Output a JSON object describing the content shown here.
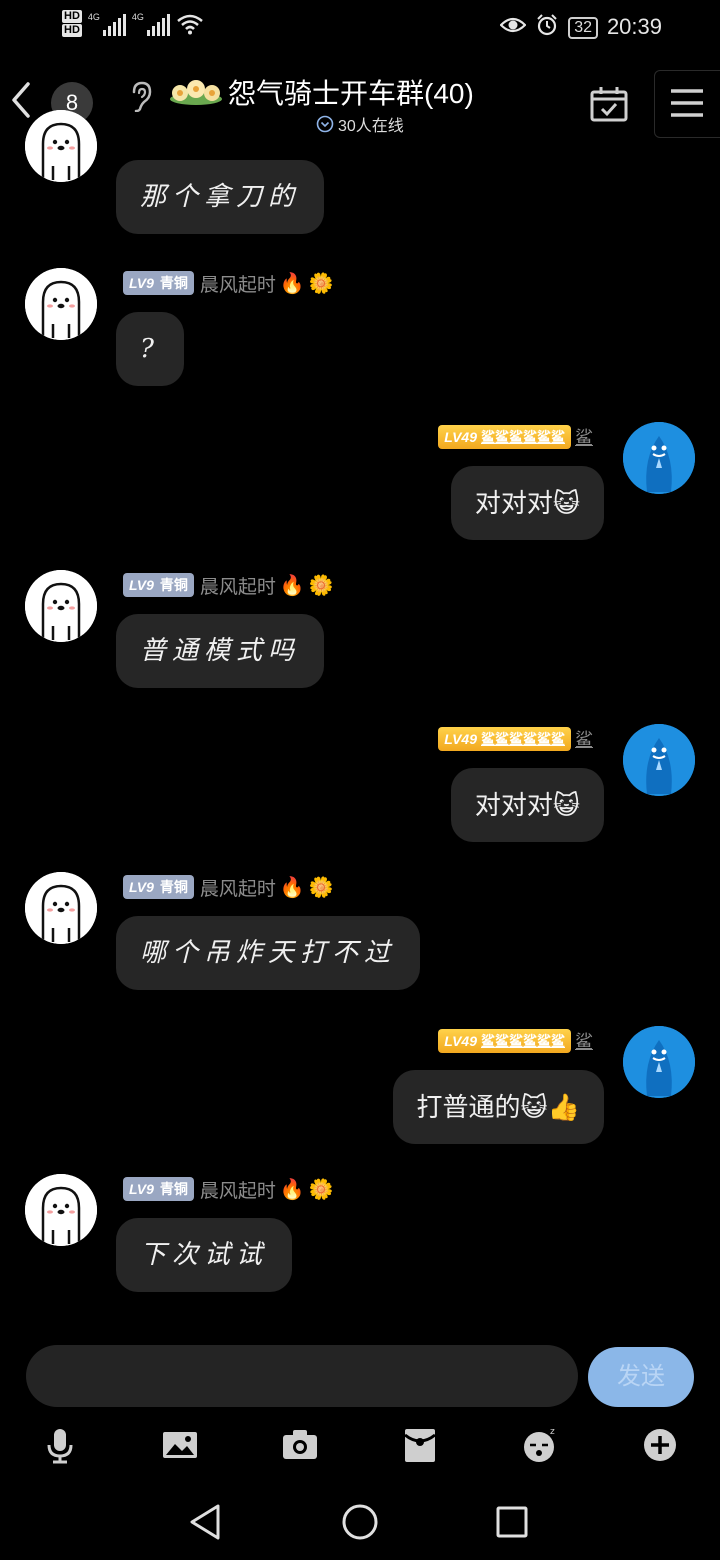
{
  "status": {
    "hd1": "HD",
    "hd2": "HD",
    "net1": "4G",
    "net2": "4G",
    "battery": "32",
    "time": "20:39"
  },
  "header": {
    "unread": "8",
    "title": "怨气骑士开车群(40)",
    "online": "30人在线"
  },
  "messages": [
    {
      "side": "left",
      "level": "",
      "rank": "",
      "nick": "",
      "text": "那个拿刀的"
    },
    {
      "side": "left",
      "level": "LV9",
      "rank": "青铜",
      "nick": "晨风起时",
      "text": "?"
    },
    {
      "side": "right",
      "level": "LV49",
      "rank": "鲨鲨鲨鲨鲨鲨",
      "nick": "鲨",
      "text": "对对对"
    },
    {
      "side": "left",
      "level": "LV9",
      "rank": "青铜",
      "nick": "晨风起时",
      "text": "普通模式吗"
    },
    {
      "side": "right",
      "level": "LV49",
      "rank": "鲨鲨鲨鲨鲨鲨",
      "nick": "鲨",
      "text": "对对对"
    },
    {
      "side": "left",
      "level": "LV9",
      "rank": "青铜",
      "nick": "晨风起时",
      "text": "哪个吊炸天打不过"
    },
    {
      "side": "right",
      "level": "LV49",
      "rank": "鲨鲨鲨鲨鲨鲨",
      "nick": "鲨",
      "text": "打普通的"
    },
    {
      "side": "left",
      "level": "LV9",
      "rank": "青铜",
      "nick": "晨风起时",
      "text": "下次试试"
    }
  ],
  "input": {
    "placeholder": "",
    "send": "发送"
  },
  "icons": {
    "emoji_fire": "🔥",
    "emoji_flower": "🌼",
    "emoji_cat": "😺",
    "emoji_thumb": "👍"
  }
}
